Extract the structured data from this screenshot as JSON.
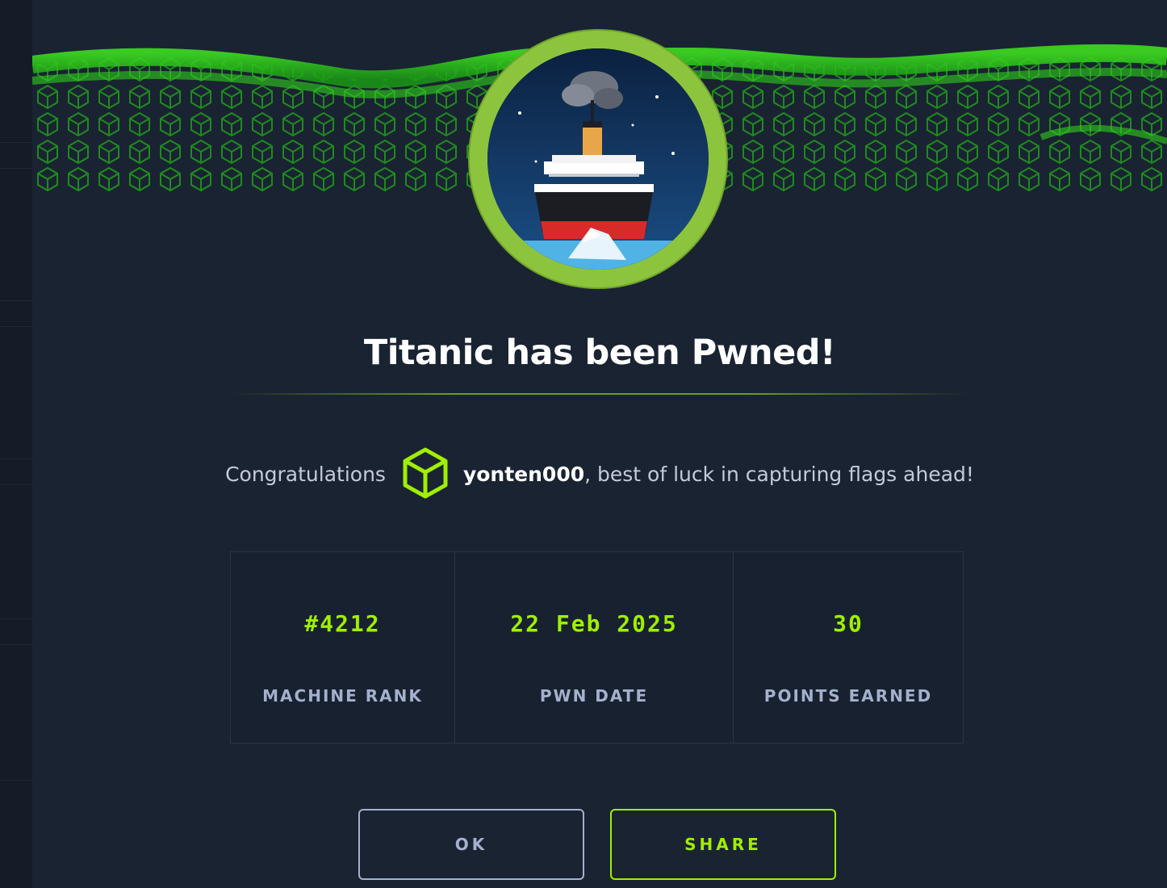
{
  "modal": {
    "title": "Titanic has been Pwned!",
    "congrats_prefix": "Congratulations",
    "username": "yonten000",
    "congrats_suffix": ", best of luck in capturing flags ahead!",
    "avatar_icon": "ship-icebreaker-icon",
    "user_badge_icon": "hackthebox-cube-icon"
  },
  "stats": [
    {
      "value": "#4212",
      "label": "MACHINE RANK"
    },
    {
      "value": "22 Feb 2025",
      "label": "PWN DATE"
    },
    {
      "value": "30",
      "label": "POINTS EARNED"
    }
  ],
  "buttons": {
    "ok_label": "OK",
    "share_label": "SHARE"
  },
  "colors": {
    "accent": "#9fef00",
    "background": "#1a2332",
    "avatar_ring": "#8dc43d",
    "muted_text": "#a4b1cd"
  }
}
